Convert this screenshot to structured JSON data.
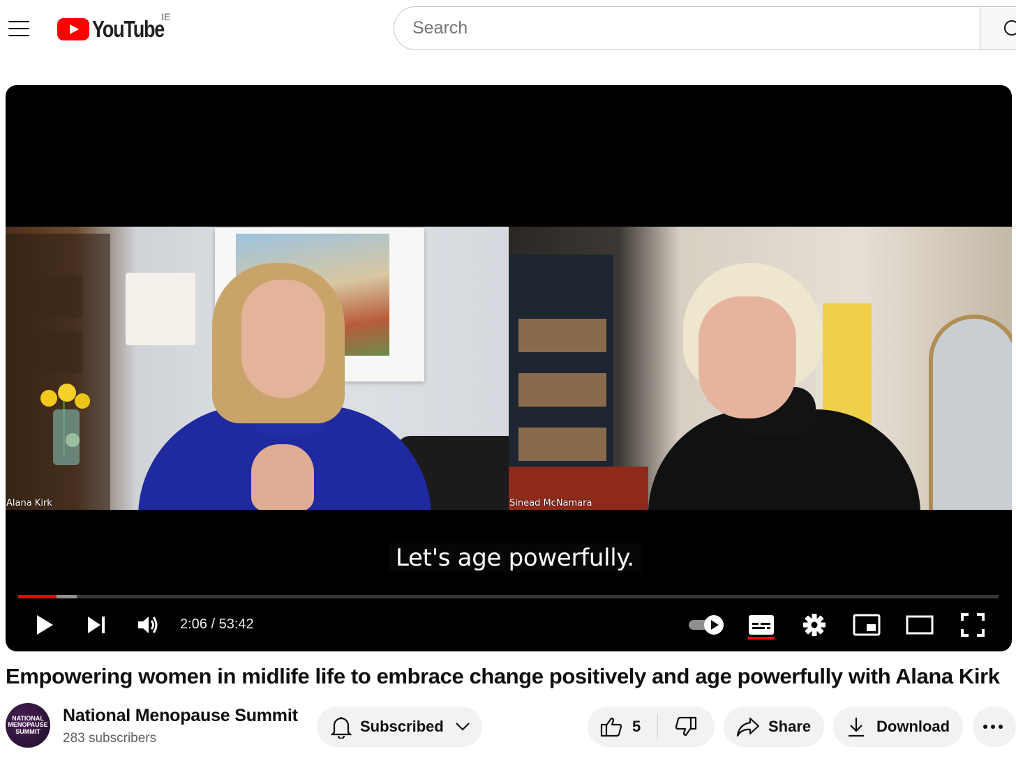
{
  "header": {
    "logo_text": "YouTube",
    "country_code": "IE",
    "search_placeholder": "Search"
  },
  "player": {
    "participants": [
      "Alana Kirk",
      "Sinead McNamara"
    ],
    "caption": "Let's age powerfully.",
    "current_time": "2:06",
    "duration": "53:42",
    "time_display": "2:06 / 53:42",
    "progress_played_fraction": 0.039,
    "progress_buffered_fraction": 0.06,
    "autoplay_on": true,
    "captions_on": true,
    "controls": [
      "play-icon",
      "next-icon",
      "volume-icon",
      "autoplay-toggle",
      "subtitles-icon",
      "settings-icon",
      "miniplayer-icon",
      "theater-icon",
      "fullscreen-icon"
    ]
  },
  "video": {
    "title": "Empowering women in midlife life to embrace change positively and age powerfully with Alana Kirk"
  },
  "channel": {
    "name": "National Menopause Summit",
    "subscribers": "283 subscribers",
    "avatar_text": "NATIONAL MENOPAUSE SUMMIT"
  },
  "actions": {
    "subscribed_label": "Subscribed",
    "like_count": "5",
    "share_label": "Share",
    "download_label": "Download"
  },
  "colors": {
    "brand_red": "#ff0000",
    "pill_bg": "#f2f2f2",
    "text_primary": "#0f0f0f",
    "text_secondary": "#606060"
  }
}
